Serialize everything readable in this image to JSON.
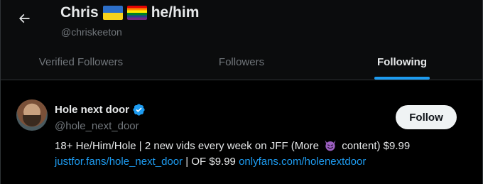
{
  "header": {
    "name": "Chris",
    "pronouns": "he/him",
    "handle": "@chriskeeton",
    "flags": [
      "ukraine-flag-icon",
      "rainbow-flag-icon"
    ]
  },
  "tabs": [
    {
      "label": "Verified Followers",
      "active": false
    },
    {
      "label": "Followers",
      "active": false
    },
    {
      "label": "Following",
      "active": true
    }
  ],
  "user": {
    "display_name": "Hole next door",
    "handle": "@hole_next_door",
    "follow_label": "Follow",
    "bio_line1_pre": "18+ He/Him/Hole | 2 new vids every week on JFF (More",
    "bio_line1_post": "content) $9.99",
    "bio_link1": "justfor.fans/hole_next_door",
    "bio_mid": " | OF $9.99 ",
    "bio_link2": "onlyfans.com/holenextdoor"
  },
  "colors": {
    "accent": "#1d9bf0",
    "background": "#000000",
    "muted_text": "#71767b",
    "primary_text": "#e7e9ea"
  }
}
